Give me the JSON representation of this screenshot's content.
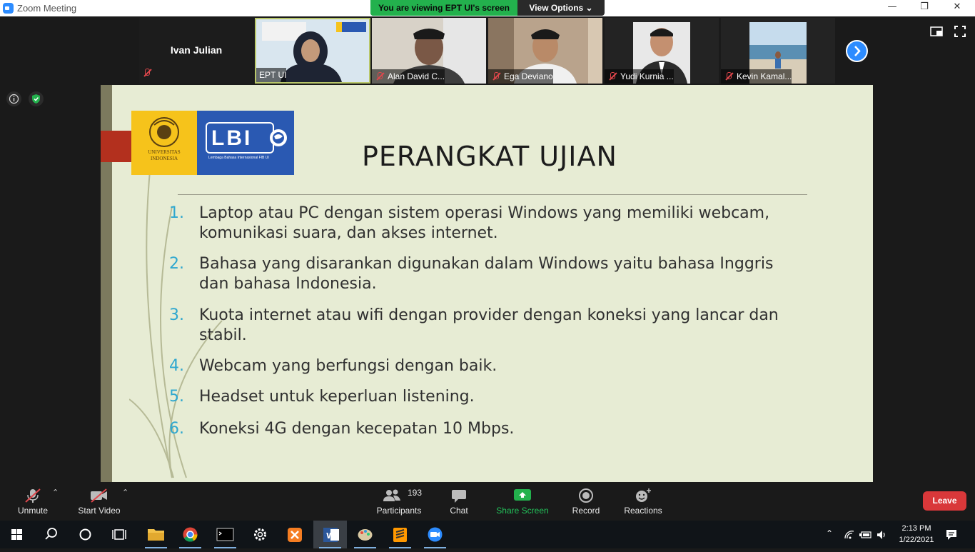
{
  "window": {
    "title": "Zoom Meeting",
    "minimize": "—",
    "maximize": "❐",
    "close": "✕"
  },
  "share_banner": {
    "status": "You are viewing EPT UI's screen",
    "view_options": "View Options ⌄"
  },
  "participants_strip": {
    "active_speaker": "Ivan Julian",
    "tiles": [
      {
        "name": "EPT UI",
        "muted": false
      },
      {
        "name": "Alan David C...",
        "muted": true
      },
      {
        "name": "Ega Deviano",
        "muted": true
      },
      {
        "name": "Yudi Kurnia ...",
        "muted": true
      },
      {
        "name": "Kevin Kamal...",
        "muted": true
      }
    ]
  },
  "slide": {
    "logo_left_text": "UNIVERSITAS INDONESIA",
    "logo_right_text": "LBI",
    "logo_right_subtext": "Lembaga Bahasa Internasional FIB UI",
    "title": "PERANGKAT  UJIAN",
    "items": [
      {
        "num": "1.",
        "text": "Laptop atau PC dengan sistem operasi Windows yang memiliki webcam, komunikasi suara, dan akses internet."
      },
      {
        "num": "2.",
        "text": "Bahasa yang disarankan digunakan dalam Windows yaitu bahasa Inggris dan bahasa Indonesia."
      },
      {
        "num": "3.",
        "text": "Kuota internet atau wifi dengan provider dengan koneksi yang lancar dan stabil."
      },
      {
        "num": "4.",
        "text": "Webcam yang berfungsi dengan baik."
      },
      {
        "num": "5.",
        "text": "Headset untuk keperluan listening."
      },
      {
        "num": "6.",
        "text": "Koneksi 4G dengan kecepatan 10 Mbps."
      }
    ]
  },
  "toolbar": {
    "unmute": "Unmute",
    "start_video": "Start Video",
    "participants": "Participants",
    "participant_count": "193",
    "chat": "Chat",
    "share_screen": "Share Screen",
    "record": "Record",
    "reactions": "Reactions",
    "leave": "Leave"
  },
  "taskbar": {
    "time": "2:13 PM",
    "date": "1/22/2021"
  },
  "colors": {
    "zoom_blue": "#2d8cff",
    "share_green": "#23b14d",
    "leave_red": "#d9383a",
    "slide_bg": "#e7ecd4",
    "list_number": "#2ea7cf"
  }
}
